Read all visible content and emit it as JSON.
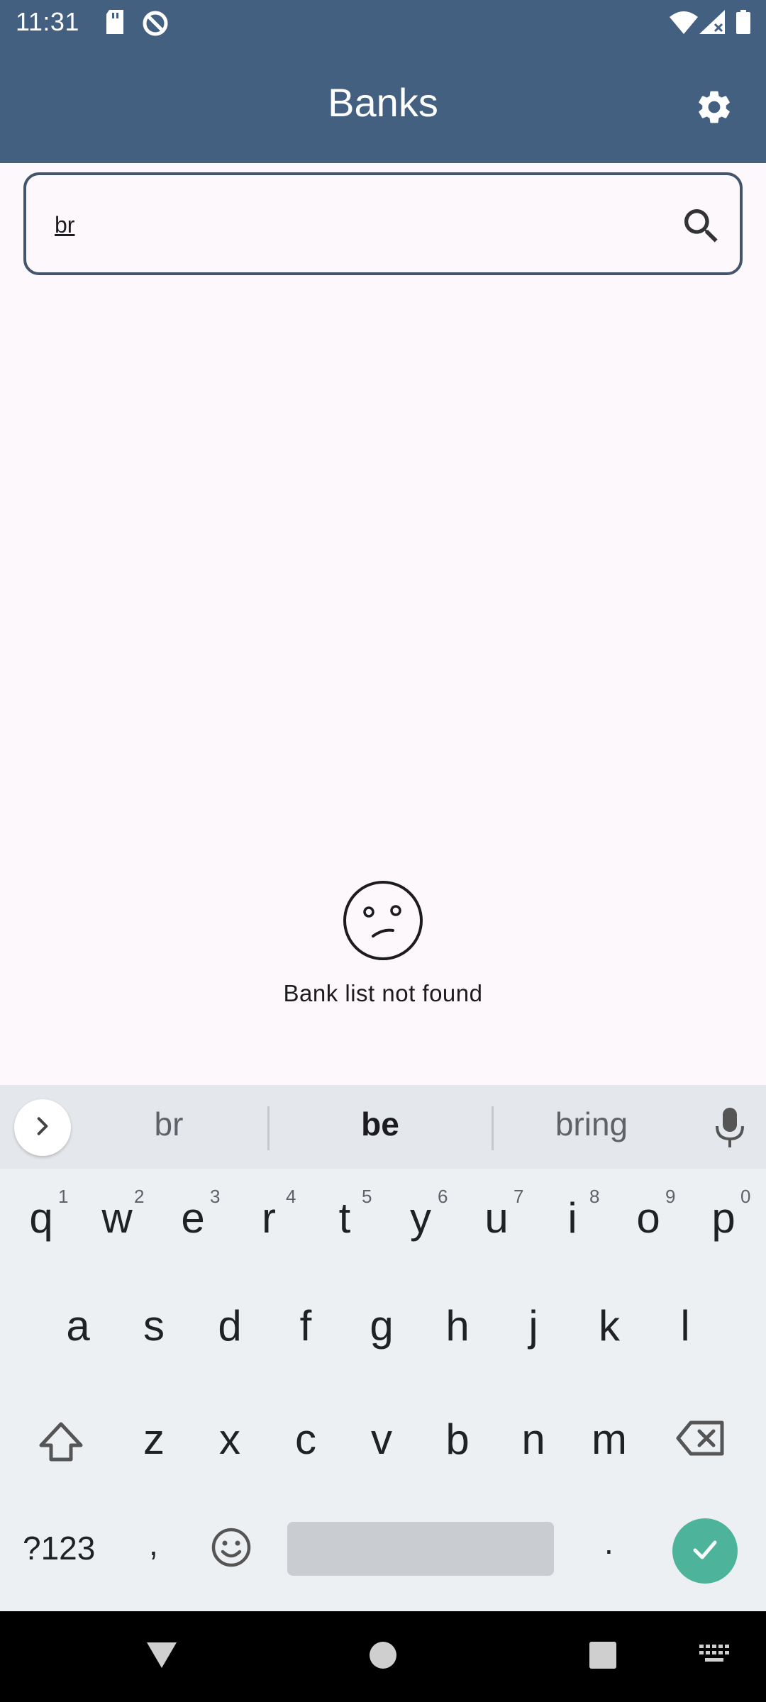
{
  "status_bar": {
    "time": "11:31",
    "icons": [
      "sd-card-icon",
      "data-saver-icon",
      "wifi-icon",
      "signal-icon",
      "battery-icon"
    ]
  },
  "app_bar": {
    "title": "Banks",
    "background_color": "#436081",
    "settings_icon": "gear-icon"
  },
  "search": {
    "value": "br",
    "icon": "search-icon"
  },
  "empty_state": {
    "icon": "confused-face-icon",
    "message": "Bank list not found"
  },
  "keyboard": {
    "suggestions": [
      "br",
      "be",
      "bring"
    ],
    "highlighted_suggestion": "be",
    "row1": [
      "q",
      "w",
      "e",
      "r",
      "t",
      "y",
      "u",
      "i",
      "o",
      "p"
    ],
    "row1_hints": [
      "1",
      "2",
      "3",
      "4",
      "5",
      "6",
      "7",
      "8",
      "9",
      "0"
    ],
    "row2": [
      "a",
      "s",
      "d",
      "f",
      "g",
      "h",
      "j",
      "k",
      "l"
    ],
    "row3": [
      "z",
      "x",
      "c",
      "v",
      "b",
      "n",
      "m"
    ],
    "symbols_label": "?123",
    "comma_label": ",",
    "period_label": ".",
    "enter_color": "#4db39a"
  },
  "nav_bar": {
    "icons": [
      "back-icon",
      "home-icon",
      "recents-icon",
      "keyboard-switch-icon"
    ]
  }
}
